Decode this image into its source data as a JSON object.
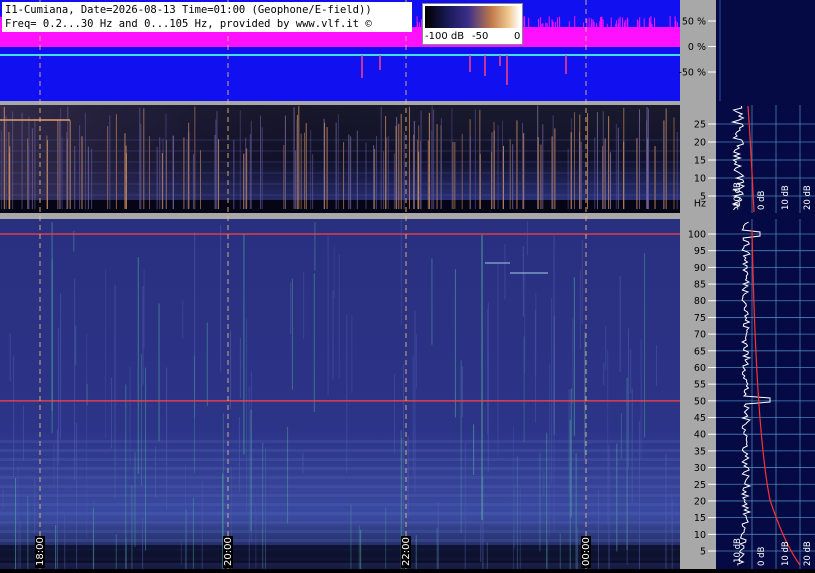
{
  "header": {
    "line1": "I1-Cumiana, Date=2026-08-13 Time=01:00 (Geophone/E-field))",
    "line2": "Freq= 0.2...30 Hz and 0...105 Hz, provided by www.vlf.it ©"
  },
  "colorbar": {
    "label_low": "-100 dB",
    "label_mid": "-50",
    "label_high": "0"
  },
  "colors": {
    "wave_bg": "#1010f0",
    "wave_magenta": "#ff10ff",
    "wave_trace": "#40e0f0",
    "spec_bg_dark": "#050515",
    "spec_bg": "#2a2f78",
    "side_panel": "#050a45",
    "grid": "#5aa0d0",
    "marker_line": "#ff4040",
    "axis_panel": "#a8a8a8"
  },
  "chart_data": [
    {
      "type": "line",
      "panel": "waveform",
      "ylabel": "",
      "y_ticks": [
        "50 %",
        "0 %",
        "-50 %"
      ],
      "ylim": [
        -100,
        100
      ]
    },
    {
      "type": "heatmap",
      "panel": "spectrogram-low",
      "y_unit_label": "Hz",
      "y_ticks": [
        25,
        20,
        15,
        10,
        5
      ],
      "ylim": [
        0.2,
        30
      ],
      "side_ticks": [
        "-10 dB",
        "0 dB",
        "10 dB",
        "20 dB"
      ]
    },
    {
      "type": "heatmap",
      "panel": "spectrogram-high",
      "y_ticks": [
        100,
        95,
        90,
        85,
        80,
        75,
        70,
        65,
        60,
        55,
        50,
        45,
        40,
        35,
        30,
        25,
        20,
        15,
        10,
        5
      ],
      "ylim": [
        0,
        105
      ],
      "x_ticks": [
        "18:00",
        "20:00",
        "22:00",
        "00:00"
      ],
      "marker_lines_hz": [
        50,
        100
      ],
      "side_ticks": [
        "-10 dB",
        "0 dB",
        "10 dB",
        "20 dB"
      ]
    }
  ]
}
